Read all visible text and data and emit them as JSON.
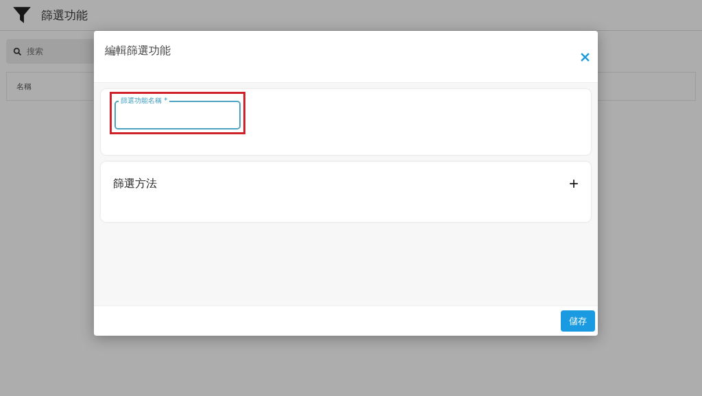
{
  "page": {
    "title": "篩選功能",
    "search": {
      "placeholder": "搜索"
    },
    "table": {
      "columns": [
        "名稱"
      ]
    }
  },
  "dialog": {
    "title": "編輯篩選功能",
    "name_field": {
      "label": "篩選功能名稱 *",
      "highlighted": true
    },
    "section": {
      "title": "篩選方法",
      "add": "+"
    },
    "buttons": [
      "儲存"
    ]
  }
}
